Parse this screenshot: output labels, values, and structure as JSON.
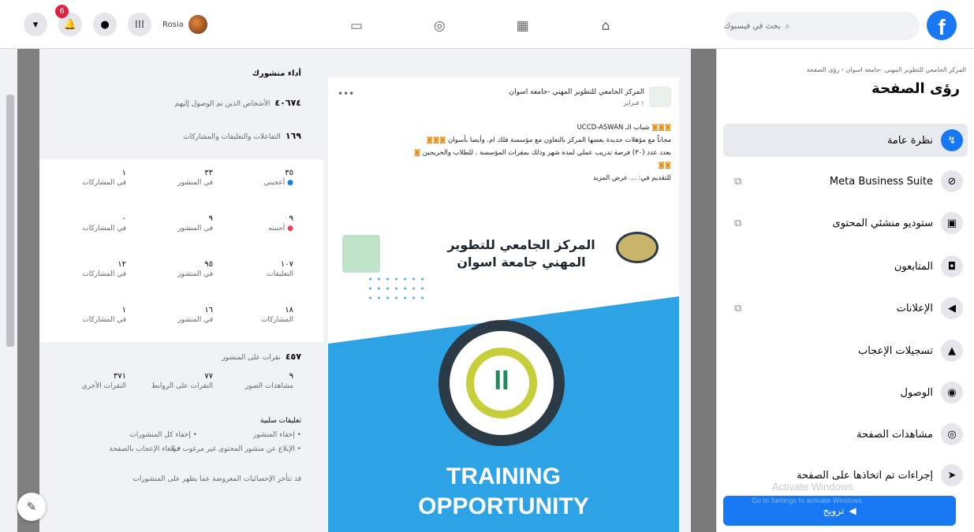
{
  "header": {
    "notification_count": "6",
    "profile_name": "Rosia",
    "search_placeholder": "بحث في فيسبوك",
    "brand_color": "#1877f2"
  },
  "insights": {
    "title": "أداء منشورك",
    "reach_value": "٤٠٦٧٤",
    "reach_label": "الأشخاص الذين تم الوصول إليهم",
    "engagement_value": "١٦٩",
    "engagement_label": "التفاعلات والتعليقات والمشاركات",
    "grid": [
      {
        "total": "٣٥",
        "total_label": "أعجبني",
        "post": "٣٣",
        "post_label": "في المنشور",
        "share": "١",
        "share_label": "في المشاركات"
      },
      {
        "total": "٩",
        "total_label": "أحببته",
        "post": "٩",
        "post_label": "في المنشور",
        "share": "٠",
        "share_label": "في المشاركات"
      },
      {
        "total": "١٠٧",
        "total_label": "التعليقات",
        "post": "٩٥",
        "post_label": "في المنشور",
        "share": "١٢",
        "share_label": "في المشاركات"
      },
      {
        "total": "١٨",
        "total_label": "المشاركات",
        "post": "١٦",
        "post_label": "في المنشور",
        "share": "١",
        "share_label": "في المشاركات"
      }
    ],
    "clicks_value": "٤٥٧",
    "clicks_label": "نقرات على المنشور",
    "clicks_breakdown": [
      {
        "value": "٩",
        "label": "مشاهدات الصور"
      },
      {
        "value": "٧٧",
        "label": "النقرات على الروابط"
      },
      {
        "value": "٣٧١",
        "label": "النقرات الأخرى"
      }
    ],
    "negative_title": "تعليقات سلبية",
    "negative_items": [
      "• إخفاء المنشور",
      "• إخفاء كل المنشورات",
      "• الإبلاغ عن منشور المحتوى غير مرغوب فيه",
      "• إلغاء الإعجاب بالصفحة"
    ],
    "footnote": "قد تتأخر الإحصائيات المعروضة عما يظهر على المنشورات"
  },
  "post": {
    "page_name": "المركز الجامعي للتطوير المهني -جامعة اسوان",
    "meta": "١ فبراير",
    "line1": "شباب الـ UCCD-ASWAN",
    "line2": "مجاناً مع مؤهلات جديدة بعضها المركز بالتعاون مع مؤسسة فلك ام. وأيضا بأسوان",
    "line3": "بعدد عدد (٣٠) فرصة تدريب عملي لمدة شهر وذلك بمقرات المؤسسة . للطلاب والخريجين",
    "line4": "للتقديم في: ... عرض المزيد",
    "image_title": "المركز الجامعي للتطوير المهني جامعة اسوان",
    "image_word1": "TRAINING",
    "image_word2": "OPPORTUNITY"
  },
  "sidebar": {
    "breadcrumb": "المركز الجامعي للتطوير المهني -جامعة اسوان › رؤى الصفحة",
    "title": "رؤى الصفحة",
    "items": [
      {
        "label": "نظرة عامة",
        "icon": "overview-icon",
        "glyph": "↯"
      },
      {
        "label": "Meta Business Suite",
        "icon": "meta-business-icon",
        "glyph": "⊘"
      },
      {
        "label": "ستوديو منشئي المحتوى",
        "icon": "creator-studio-icon",
        "glyph": "▣"
      },
      {
        "label": "المتابعون",
        "icon": "followers-icon",
        "glyph": "◘"
      },
      {
        "label": "الإعلانات",
        "icon": "megaphone-icon",
        "glyph": "📢"
      },
      {
        "label": "تسجيلات الإعجاب",
        "icon": "thumbs-up-icon",
        "glyph": "👍"
      },
      {
        "label": "الوصول",
        "icon": "reach-icon",
        "glyph": "◉"
      },
      {
        "label": "مشاهدات الصفحة",
        "icon": "eye-icon",
        "glyph": "👁"
      },
      {
        "label": "إجراءات تم اتخاذها على الصفحة",
        "icon": "cursor-icon",
        "glyph": "➤"
      }
    ],
    "promote_label": "ترويج",
    "watermark_line1": "Activate Windows",
    "watermark_line2": "Go to Settings to activate Windows."
  }
}
